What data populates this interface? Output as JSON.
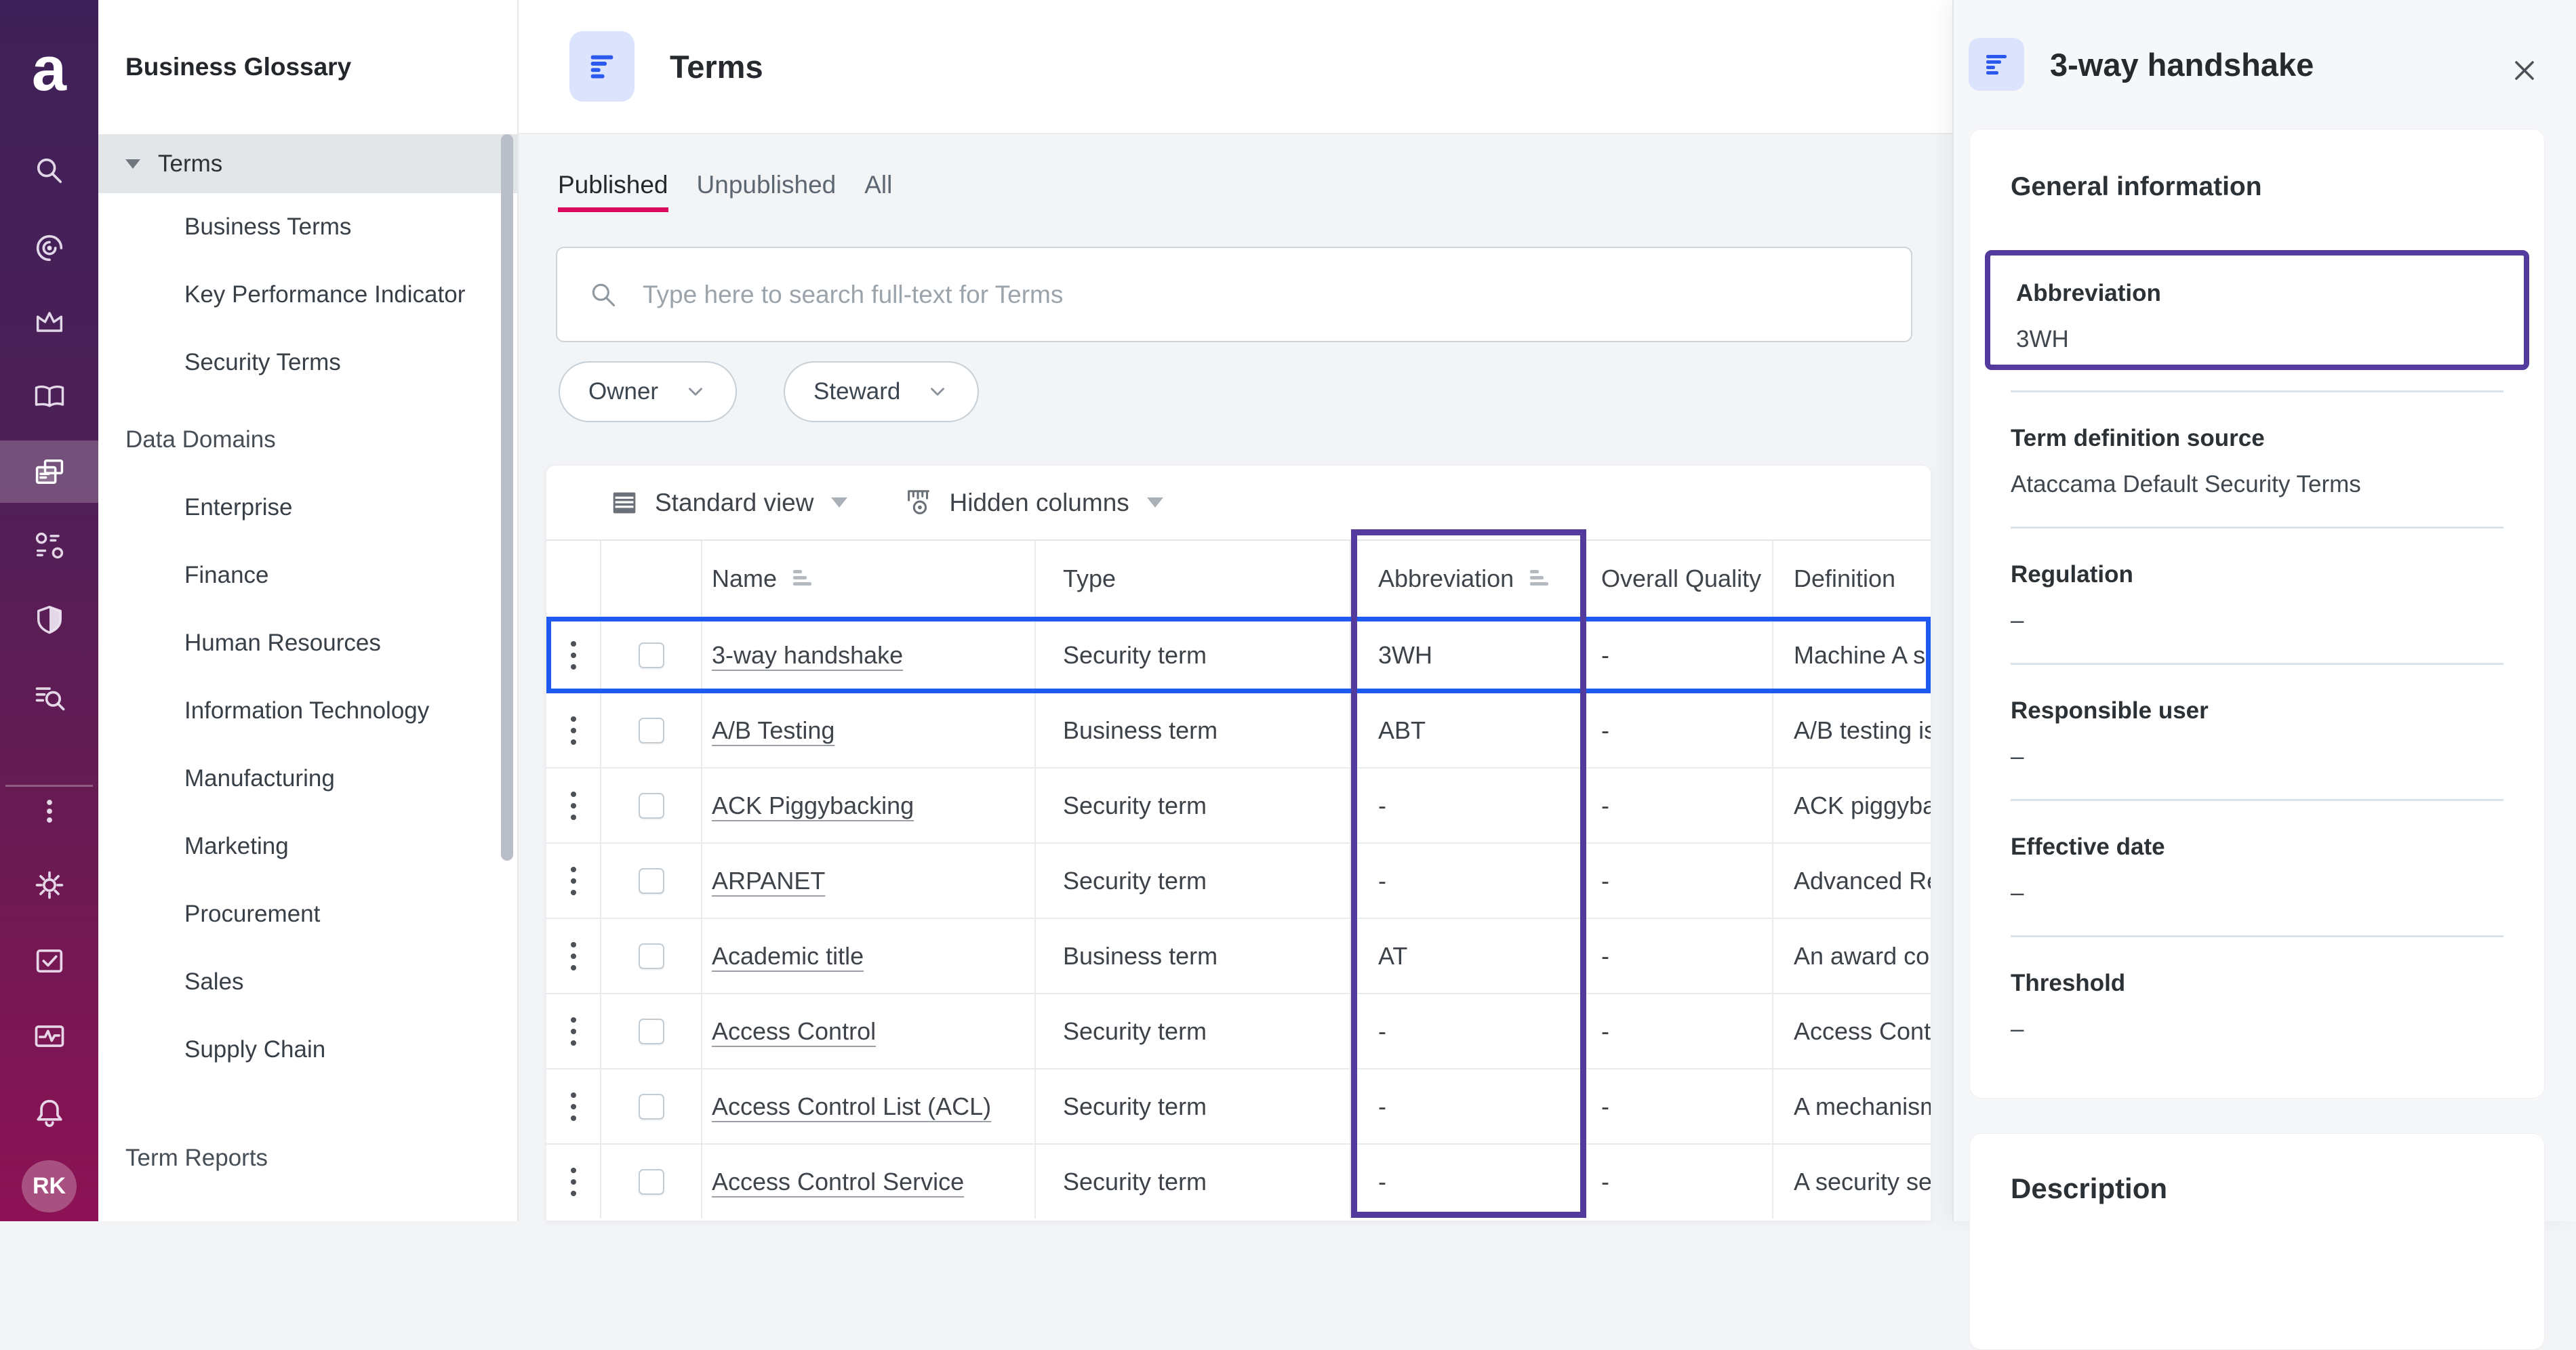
{
  "app": {
    "logo_letter": "a",
    "avatar_initials": "RK",
    "rail_icons_top": [
      "search",
      "data-discovery",
      "crown",
      "knowledge-catalog",
      "business-glossary",
      "org-structure",
      "shield",
      "data-quality"
    ],
    "rail_active_icon": "business-glossary",
    "rail_icons_bottom": [
      "more-kebab",
      "settings-gear",
      "tasks-check",
      "monitoring-pulse",
      "notifications-bell"
    ]
  },
  "sidebar": {
    "title": "Business Glossary",
    "sections": [
      {
        "header": {
          "label": "Terms",
          "selected": true,
          "expanded": true
        },
        "items": [
          "Business Terms",
          "Key Performance Indicator",
          "Security Terms"
        ]
      },
      {
        "header": {
          "label": "Data Domains",
          "selected": false,
          "expanded": false
        },
        "items": [
          "Enterprise",
          "Finance",
          "Human Resources",
          "Information Technology",
          "Manufacturing",
          "Marketing",
          "Procurement",
          "Sales",
          "Supply Chain"
        ]
      },
      {
        "header": {
          "label": "Term Reports",
          "selected": false,
          "expanded": false
        },
        "items": []
      }
    ]
  },
  "main": {
    "title": "Terms",
    "tabs": [
      {
        "label": "Published",
        "active": true
      },
      {
        "label": "Unpublished",
        "active": false
      },
      {
        "label": "All",
        "active": false
      }
    ],
    "search": {
      "placeholder": "Type here to search full-text for Terms",
      "value": ""
    },
    "filters": [
      {
        "label": "Owner"
      },
      {
        "label": "Steward"
      }
    ],
    "view_selector": "Standard view",
    "columns_selector": "Hidden columns",
    "table": {
      "columns": [
        "Name",
        "Type",
        "Abbreviation",
        "Overall Quality",
        "Definition"
      ],
      "sortable_columns": [
        "Name",
        "Abbreviation"
      ],
      "highlighted_column": "Abbreviation",
      "rows": [
        {
          "name": "3-way handshake",
          "type": "Security term",
          "abbreviation": "3WH",
          "overall_quality": "-",
          "definition": "Machine A se",
          "selected": true
        },
        {
          "name": "A/B Testing",
          "type": "Business term",
          "abbreviation": "ABT",
          "overall_quality": "-",
          "definition": "A/B testing is",
          "selected": false
        },
        {
          "name": "ACK Piggybacking",
          "type": "Security term",
          "abbreviation": "-",
          "overall_quality": "-",
          "definition": "ACK piggyba",
          "selected": false
        },
        {
          "name": "ARPANET",
          "type": "Security term",
          "abbreviation": "-",
          "overall_quality": "-",
          "definition": "Advanced Re",
          "selected": false
        },
        {
          "name": "Academic title",
          "type": "Business term",
          "abbreviation": "AT",
          "overall_quality": "-",
          "definition": "An award co",
          "selected": false
        },
        {
          "name": "Access Control",
          "type": "Security term",
          "abbreviation": "-",
          "overall_quality": "-",
          "definition": "Access Cont",
          "selected": false
        },
        {
          "name": "Access Control List (ACL)",
          "type": "Security term",
          "abbreviation": "-",
          "overall_quality": "-",
          "definition": "A mechanism",
          "selected": false
        },
        {
          "name": "Access Control Service",
          "type": "Security term",
          "abbreviation": "-",
          "overall_quality": "-",
          "definition": "A security se",
          "selected": false
        }
      ]
    }
  },
  "panel": {
    "title": "3-way handshake",
    "sections": [
      {
        "heading": "General information",
        "fields": [
          {
            "label": "Abbreviation",
            "value": "3WH",
            "highlighted": true
          },
          {
            "label": "Term definition source",
            "value": "Ataccama Default Security Terms",
            "highlighted": false
          },
          {
            "label": "Regulation",
            "value": "–",
            "highlighted": false
          },
          {
            "label": "Responsible user",
            "value": "–",
            "highlighted": false
          },
          {
            "label": "Effective date",
            "value": "–",
            "highlighted": false
          },
          {
            "label": "Threshold",
            "value": "–",
            "highlighted": false
          }
        ]
      },
      {
        "heading": "Description",
        "fields": []
      }
    ]
  },
  "colors": {
    "accent_pink": "#d80a5e",
    "selection_blue": "#1d5af0",
    "highlight_purple": "#533a9d",
    "rail_top": "#3e2158",
    "rail_bottom": "#8d1255",
    "chip_blue_bg": "#dbe4fc",
    "chip_blue_fg": "#2b59ef"
  }
}
